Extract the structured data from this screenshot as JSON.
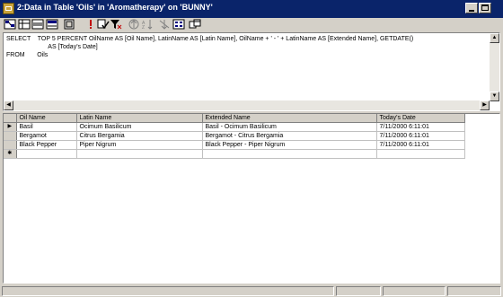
{
  "window": {
    "title": "2:Data in Table 'Oils' in 'Aromatherapy' on 'BUNNY'"
  },
  "toolbar": {
    "buttons": [
      {
        "name": "show-diagram-pane",
        "icon": "diagram-pane-icon"
      },
      {
        "name": "show-grid-pane",
        "icon": "grid-pane-icon"
      },
      {
        "name": "show-sql-pane",
        "icon": "sql-pane-icon"
      },
      {
        "name": "show-results-pane",
        "icon": "results-pane-icon"
      },
      {
        "name": "change-query-type",
        "icon": "query-type-icon"
      },
      {
        "name": "run",
        "icon": "run-icon"
      },
      {
        "name": "verify-sql",
        "icon": "verify-sql-icon"
      },
      {
        "name": "remove-filter",
        "icon": "remove-filter-icon"
      },
      {
        "name": "sort-ascending",
        "icon": "sort-ascending-icon"
      },
      {
        "name": "sort-descending",
        "icon": "sort-descending-icon"
      },
      {
        "name": "remove-sort",
        "icon": "remove-sort-icon"
      },
      {
        "name": "group-by",
        "icon": "group-by-icon"
      },
      {
        "name": "add-table",
        "icon": "add-table-icon"
      }
    ]
  },
  "sql": {
    "text": "SELECT    TOP 5 PERCENT OilName AS [Oil Name], LatinName AS [Latin Name], OilName + ' - ' + LatinName AS [Extended Name], GETDATE()\n                        AS [Today's Date]\nFROM       Oils"
  },
  "grid": {
    "columns": [
      "Oil Name",
      "Latin Name",
      "Extended Name",
      "Today's Date"
    ],
    "rows": [
      [
        "Basil",
        "Ocimum Basilicum",
        "Basil - Ocimum Basilicum",
        "7/11/2000 6:11:01"
      ],
      [
        "Bergamot",
        "Citrus Bergamia",
        "Bergamot - Citrus Bergamia",
        "7/11/2000 6:11:01"
      ],
      [
        "Black Pepper",
        "Piper Nigrum",
        "Black Pepper - Piper Nigrum",
        "7/11/2000 6:11:01"
      ]
    ],
    "current_row_marker": "▶",
    "new_row_marker": "✱"
  }
}
